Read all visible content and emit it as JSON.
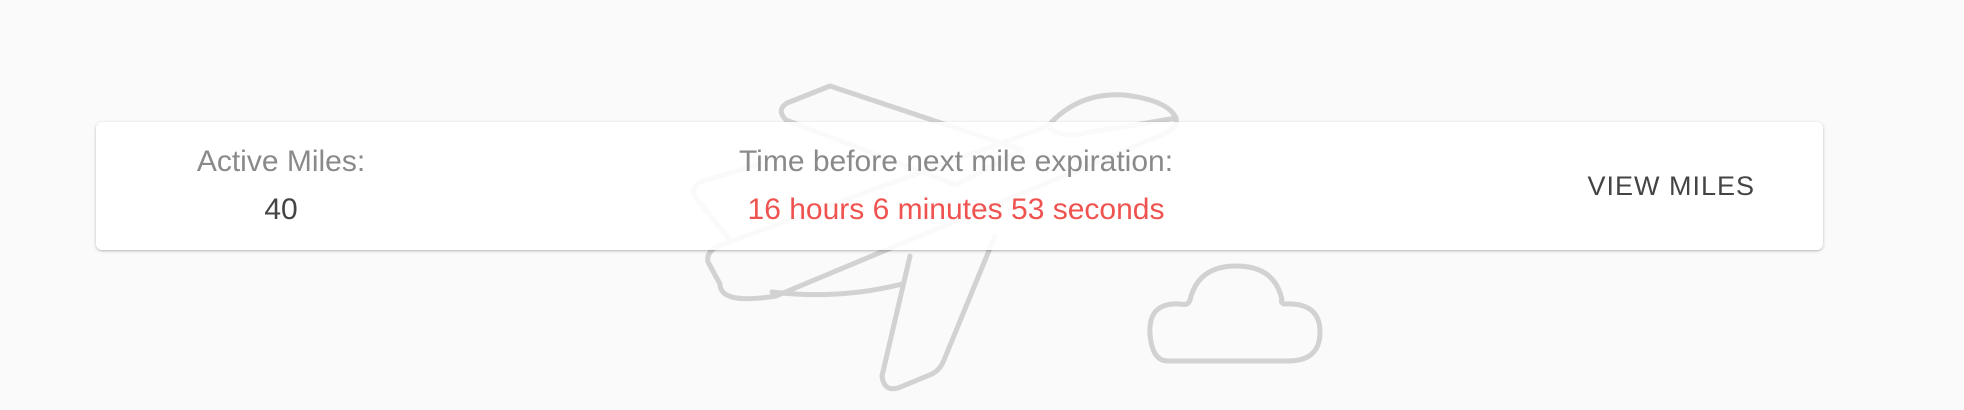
{
  "miles": {
    "label": "Active Miles:",
    "value": "40"
  },
  "expiration": {
    "label": "Time before next mile expiration:",
    "value": "16 hours 6 minutes 53 seconds",
    "value_color": "#ef5350"
  },
  "actions": {
    "view_miles_label": "VIEW MILES"
  },
  "icons": [
    "airplane-icon",
    "cloud-icon"
  ]
}
